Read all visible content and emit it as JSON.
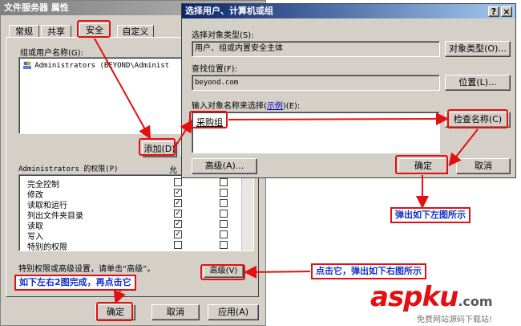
{
  "props_dialog": {
    "title": "文件服务器 属性",
    "tabs": [
      "常规",
      "共享",
      "安全",
      "自定义"
    ],
    "users_label": "组或用户名称(G):",
    "user_item": "Administrators (BEYOND\\Administ",
    "add_button": "添加(D)",
    "perm_header": "Administrators 的权限(P)",
    "perm_allow_col": "允",
    "permissions": [
      {
        "label": "完全控制",
        "allow": false,
        "deny": false
      },
      {
        "label": "修改",
        "allow": true,
        "deny": false
      },
      {
        "label": "读取和运行",
        "allow": true,
        "deny": false
      },
      {
        "label": "列出文件夹目录",
        "allow": true,
        "deny": false
      },
      {
        "label": "读取",
        "allow": true,
        "deny": false
      },
      {
        "label": "写入",
        "allow": true,
        "deny": false
      },
      {
        "label": "特别的权限",
        "allow": false,
        "deny": false
      }
    ],
    "special_text": "特别权限或高级设置，请单击“高级”。",
    "advanced_button": "高级(V)",
    "ok_button": "确定",
    "cancel_button": "取消",
    "apply_button": "应用(A)"
  },
  "select_dialog": {
    "title": "选择用户、计算机或组",
    "help_button": "?",
    "close_button": "×",
    "object_type_label": "选择对象类型(S):",
    "object_type_value": "用户、组或内置安全主体",
    "object_type_button": "对象类型(O)...",
    "location_label": "查找位置(F):",
    "location_value": "beyond.com",
    "location_button": "位置(L)...",
    "input_label_pre": "输入对象名称来选择(",
    "input_label_link": "示例",
    "input_label_post": ")(E):",
    "input_value": "采购组",
    "check_names_button": "检查名称(C)",
    "advanced_button": "高级(A)...",
    "ok_button": "确定",
    "cancel_button": "取消"
  },
  "annotations": {
    "popup_note": "弹出如下左图所示",
    "click_note": "点击它，弹出如下右图所示",
    "done_note": "如下左右2图完成，再点击它"
  },
  "watermark": {
    "logo_text": "aspku",
    "logo_suffix": ".com",
    "tagline": "免费网站源码下载站!"
  }
}
